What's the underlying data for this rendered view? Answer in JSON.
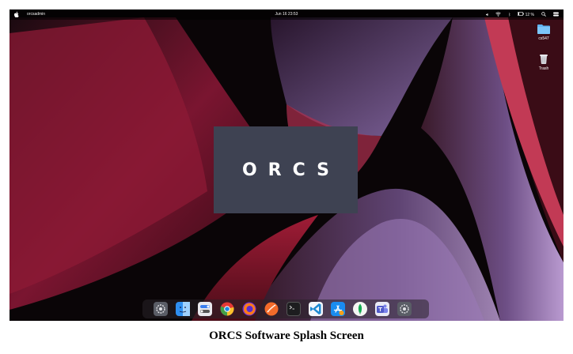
{
  "menubar": {
    "active_app": "orcsadmin",
    "clock": "Jun 16  23:53",
    "battery": "12 %"
  },
  "desktop_icons": [
    {
      "name": "folder-icon",
      "label": "cs547"
    },
    {
      "name": "trash-icon",
      "label": "Trash"
    }
  ],
  "splash": {
    "logo_text": "ORCS",
    "background": "#3e4252"
  },
  "dock": {
    "items": [
      "system-preferences-icon",
      "finder-icon",
      "control-center-icon",
      "chrome-icon",
      "firefox-icon",
      "swift-icon",
      "terminal-icon",
      "vscode-icon",
      "app-store-icon",
      "mongodb-compass-icon",
      "teams-icon",
      "system-preferences-icon"
    ]
  },
  "caption": "ORCS Software Splash Screen",
  "colors": {
    "wallpaper_red": "#8a1530",
    "wallpaper_purple": "#6b4a8a",
    "splash_bg": "#3e4252"
  }
}
